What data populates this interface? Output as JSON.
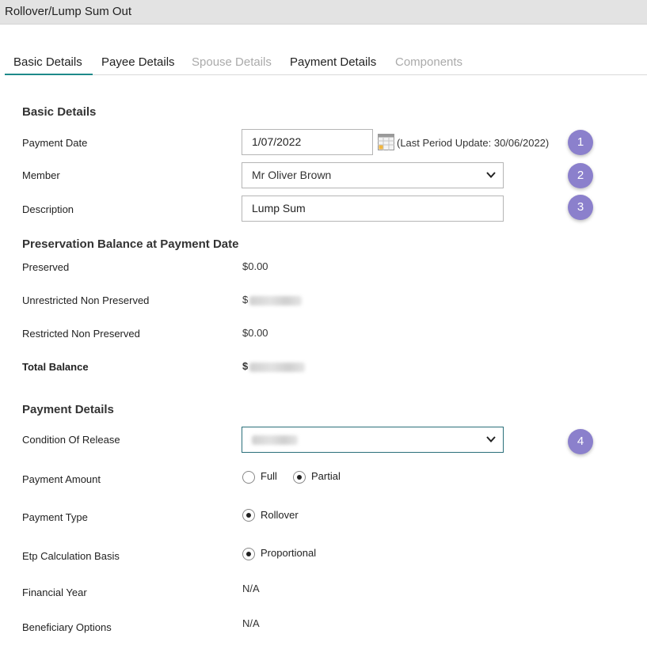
{
  "window": {
    "title": "Rollover/Lump Sum Out"
  },
  "tabs": [
    {
      "label": "Basic Details",
      "state": "active"
    },
    {
      "label": "Payee Details",
      "state": "enabled"
    },
    {
      "label": "Spouse Details",
      "state": "disabled"
    },
    {
      "label": "Payment Details",
      "state": "enabled"
    },
    {
      "label": "Components",
      "state": "disabled"
    }
  ],
  "basic_details": {
    "heading": "Basic Details",
    "payment_date_label": "Payment Date",
    "payment_date_value": "1/07/2022",
    "last_period_update": "(Last Period Update: 30/06/2022)",
    "member_label": "Member",
    "member_value": "Mr Oliver Brown",
    "description_label": "Description",
    "description_value": "Lump Sum"
  },
  "preservation": {
    "heading": "Preservation Balance at Payment Date",
    "preserved_label": "Preserved",
    "preserved_value": "$0.00",
    "unrestricted_label": "Unrestricted Non Preserved",
    "unrestricted_value": "$",
    "restricted_label": "Restricted Non Preserved",
    "restricted_value": "$0.00",
    "total_label": "Total Balance",
    "total_value": "$"
  },
  "payment_details": {
    "heading": "Payment Details",
    "condition_label": "Condition Of Release",
    "payment_amount_label": "Payment Amount",
    "payment_amount_options": [
      {
        "label": "Full",
        "selected": false
      },
      {
        "label": "Partial",
        "selected": true
      }
    ],
    "payment_type_label": "Payment Type",
    "payment_type_option": {
      "label": "Rollover",
      "selected": true
    },
    "etp_label": "Etp Calculation Basis",
    "etp_option": {
      "label": "Proportional",
      "selected": true
    },
    "financial_year_label": "Financial Year",
    "financial_year_value": "N/A",
    "beneficiary_label": "Beneficiary Options",
    "beneficiary_value": "N/A"
  },
  "annotations": [
    "1",
    "2",
    "3",
    "4"
  ],
  "colors": {
    "accent_teal": "#1e8a8a",
    "badge_purple": "#8b80cc",
    "titlebar_bg": "#e3e3e3",
    "disabled_text": "#aaaaaa"
  },
  "icons": {
    "calendar": "calendar-icon",
    "dropdown": "chevron-down-icon"
  }
}
